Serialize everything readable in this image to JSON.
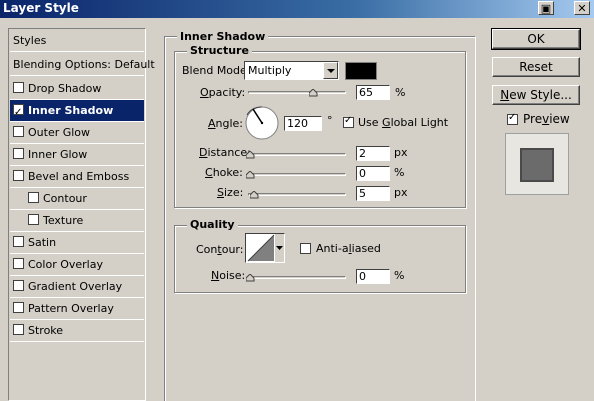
{
  "window": {
    "title": "Layer Style"
  },
  "sidebar": {
    "items": [
      {
        "label": "Styles",
        "checkbox": false
      },
      {
        "label": "Blending Options: Default",
        "checkbox": false
      },
      {
        "label": "Drop Shadow",
        "checkbox": true,
        "checked": false
      },
      {
        "label": "Inner Shadow",
        "checkbox": true,
        "checked": true,
        "selected": true
      },
      {
        "label": "Outer Glow",
        "checkbox": true,
        "checked": false
      },
      {
        "label": "Inner Glow",
        "checkbox": true,
        "checked": false
      },
      {
        "label": "Bevel and Emboss",
        "checkbox": true,
        "checked": false
      },
      {
        "label": "Contour",
        "checkbox": true,
        "checked": false
      },
      {
        "label": "Texture",
        "checkbox": true,
        "checked": false
      },
      {
        "label": "Satin",
        "checkbox": true,
        "checked": false
      },
      {
        "label": "Color Overlay",
        "checkbox": true,
        "checked": false
      },
      {
        "label": "Gradient Overlay",
        "checkbox": true,
        "checked": false
      },
      {
        "label": "Pattern Overlay",
        "checkbox": true,
        "checked": false
      },
      {
        "label": "Stroke",
        "checkbox": true,
        "checked": false
      }
    ]
  },
  "panel": {
    "title": "Inner Shadow",
    "structure": {
      "title": "Structure",
      "blend_mode_label": "Blend Mode:",
      "blend_mode_value": "Multiply",
      "shadow_color": "#000000",
      "opacity_label": "Opacity:",
      "opacity_value": "65",
      "opacity_unit": "%",
      "angle_label": "Angle:",
      "angle_value": "120",
      "angle_unit": "°",
      "global_light_label": "Use Global Light",
      "global_light_checked": true,
      "distance_label": "Distance:",
      "distance_value": "2",
      "distance_unit": "px",
      "choke_label": "Choke:",
      "choke_value": "0",
      "choke_unit": "%",
      "size_label": "Size:",
      "size_value": "5",
      "size_unit": "px"
    },
    "quality": {
      "title": "Quality",
      "contour_label": "Contour:",
      "anti_aliased_label": "Anti-aliased",
      "anti_aliased_checked": false,
      "noise_label": "Noise:",
      "noise_value": "0",
      "noise_unit": "%"
    }
  },
  "buttons": {
    "ok": "OK",
    "reset": "Reset",
    "new_style": "New Style...",
    "preview_label": "Preview",
    "preview_checked": true
  }
}
